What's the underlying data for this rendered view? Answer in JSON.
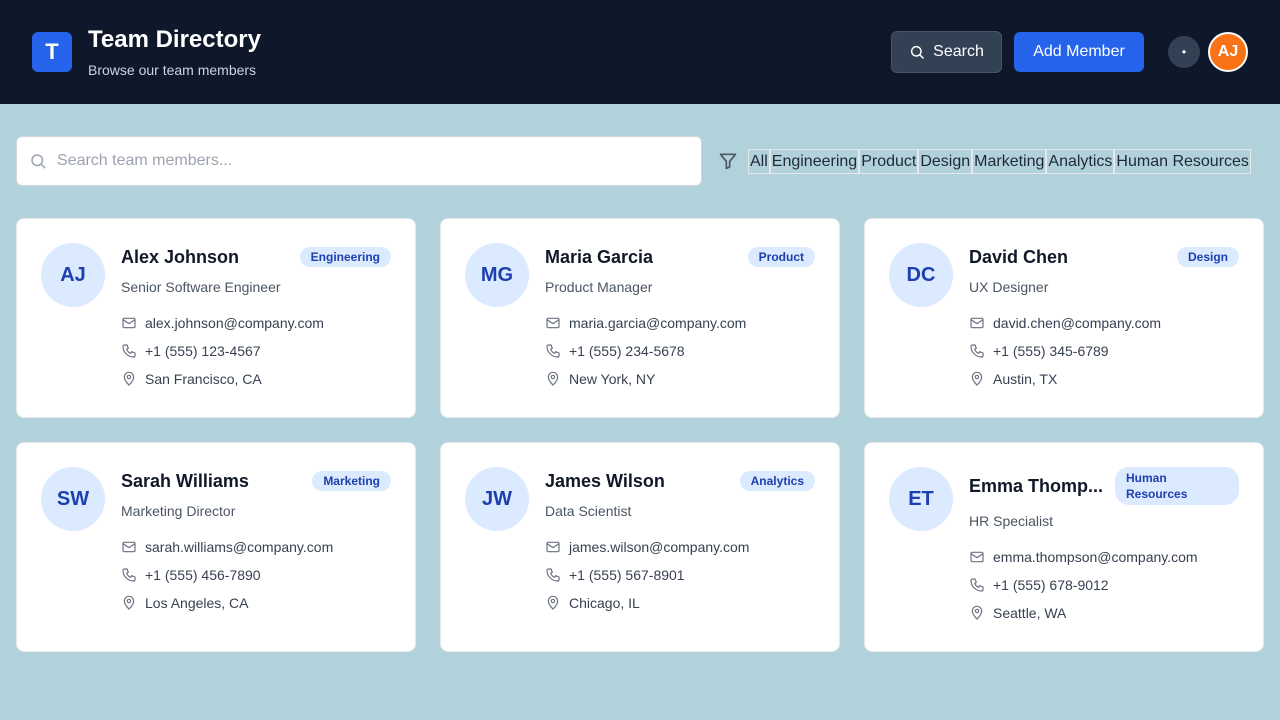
{
  "header": {
    "logo_letter": "T",
    "title": "Team Directory",
    "subtitle": "Browse our team members",
    "search_label": "Search",
    "add_label": "Add Member",
    "status_glyph": "•",
    "user_initials": "AJ"
  },
  "filter": {
    "placeholder": "Search team members...",
    "chips": [
      "All",
      "Engineering",
      "Product",
      "Design",
      "Marketing",
      "Analytics",
      "Human Resources"
    ]
  },
  "members": [
    {
      "initials": "AJ",
      "name": "Alex Johnson",
      "department": "Engineering",
      "role": "Senior Software Engineer",
      "email": "alex.johnson@company.com",
      "phone": "+1 (555) 123-4567",
      "location": "San Francisco, CA"
    },
    {
      "initials": "MG",
      "name": "Maria Garcia",
      "department": "Product",
      "role": "Product Manager",
      "email": "maria.garcia@company.com",
      "phone": "+1 (555) 234-5678",
      "location": "New York, NY"
    },
    {
      "initials": "DC",
      "name": "David Chen",
      "department": "Design",
      "role": "UX Designer",
      "email": "david.chen@company.com",
      "phone": "+1 (555) 345-6789",
      "location": "Austin, TX"
    },
    {
      "initials": "SW",
      "name": "Sarah Williams",
      "department": "Marketing",
      "role": "Marketing Director",
      "email": "sarah.williams@company.com",
      "phone": "+1 (555) 456-7890",
      "location": "Los Angeles, CA"
    },
    {
      "initials": "JW",
      "name": "James Wilson",
      "department": "Analytics",
      "role": "Data Scientist",
      "email": "james.wilson@company.com",
      "phone": "+1 (555) 567-8901",
      "location": "Chicago, IL"
    },
    {
      "initials": "ET",
      "name": "Emma Thomp...",
      "department": "Human Resources",
      "role": "HR Specialist",
      "email": "emma.thompson@company.com",
      "phone": "+1 (555) 678-9012",
      "location": "Seattle, WA"
    }
  ],
  "colors": {
    "header_bg": "#0f172a",
    "accent": "#2563eb",
    "page_bg": "#b1d2da",
    "user_avatar": "#f97316",
    "badge_bg": "#dbeafe",
    "badge_text": "#1e40af"
  },
  "icons": {
    "search": "search-icon",
    "filter": "filter-icon",
    "email": "mail-icon",
    "phone": "phone-icon",
    "location": "map-pin-icon"
  }
}
